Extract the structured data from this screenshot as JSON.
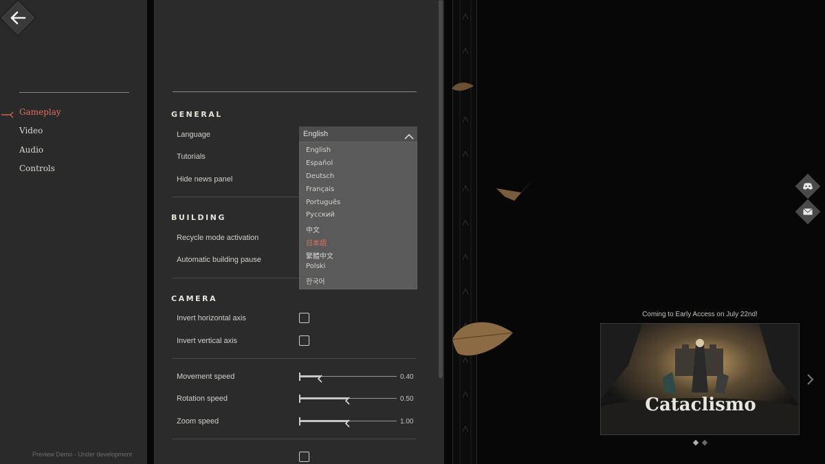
{
  "nav": {
    "items": [
      {
        "label": "Gameplay",
        "active": true
      },
      {
        "label": "Video",
        "active": false
      },
      {
        "label": "Audio",
        "active": false
      },
      {
        "label": "Controls",
        "active": false
      }
    ],
    "footer": "Preview Demo - Under development",
    "back_icon": "arrow-left-icon"
  },
  "sections": {
    "general": {
      "title": "GENERAL",
      "language_label": "Language",
      "tutorials_label": "Tutorials",
      "news_label": "Hide news panel"
    },
    "building": {
      "title": "BUILDING",
      "recycle_label": "Recycle mode activation",
      "pause_label": "Automatic building pause"
    },
    "camera": {
      "title": "CAMERA",
      "invert_h_label": "Invert horizontal axis",
      "invert_h_checked": false,
      "invert_v_label": "Invert vertical axis",
      "invert_v_checked": false,
      "movement": {
        "label": "Movement speed",
        "value": "0.40",
        "fraction": 0.22
      },
      "rotation": {
        "label": "Rotation speed",
        "value": "0.50",
        "fraction": 0.5
      },
      "zoom": {
        "label": "Zoom speed",
        "value": "1.00",
        "fraction": 0.5
      }
    }
  },
  "language_dropdown": {
    "selected": "English",
    "options": [
      {
        "label": "English",
        "highlighted": false
      },
      {
        "label": "Español",
        "highlighted": false
      },
      {
        "label": "Deutsch",
        "highlighted": false
      },
      {
        "label": "Français",
        "highlighted": false
      },
      {
        "label": "Português",
        "highlighted": false
      },
      {
        "label": "Русский",
        "highlighted": false
      },
      {
        "label": "中文",
        "highlighted": false
      },
      {
        "label": "日本語",
        "highlighted": true
      },
      {
        "label": "繁體中文",
        "highlighted": false
      },
      {
        "label": "Polski",
        "highlighted": false
      },
      {
        "label": "한국어",
        "highlighted": false
      }
    ]
  },
  "promo": {
    "caption": "Coming to Early Access on July 22nd!",
    "game_logo": "Cataclismo",
    "slides": 2,
    "active_slide": 0
  },
  "social": {
    "icons": [
      "discord-icon",
      "mail-icon"
    ]
  },
  "colors": {
    "accent": "#e0705e",
    "panel": "#2b2b2b",
    "background": "#070707"
  }
}
